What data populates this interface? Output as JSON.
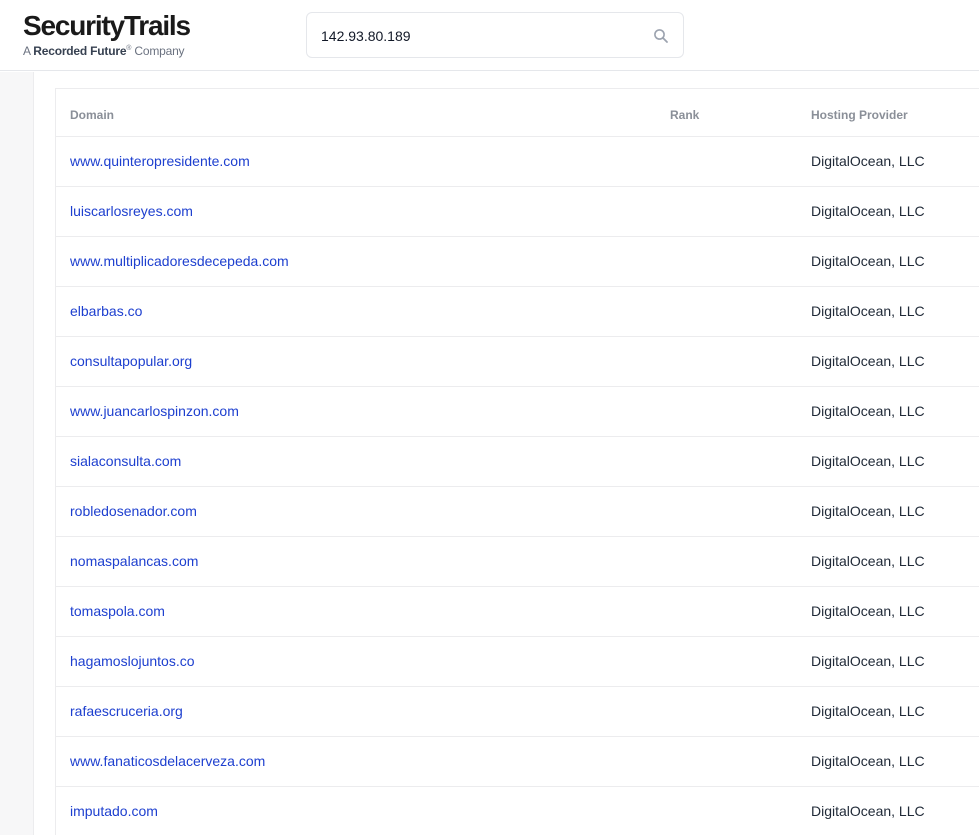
{
  "header": {
    "logo_main": "SecurityTrails",
    "logo_sub_prefix": "A ",
    "logo_sub_brand": "Recorded Future",
    "logo_sub_reg": "®",
    "logo_sub_suffix": " Company"
  },
  "search": {
    "value": "142.93.80.189",
    "icon": "search-icon"
  },
  "table": {
    "columns": {
      "domain": "Domain",
      "rank": "Rank",
      "hosting": "Hosting Provider"
    },
    "rows": [
      {
        "domain": "www.quinteropresidente.com",
        "rank": "",
        "hosting": "DigitalOcean, LLC"
      },
      {
        "domain": "luiscarlosreyes.com",
        "rank": "",
        "hosting": "DigitalOcean, LLC"
      },
      {
        "domain": "www.multiplicadoresdecepeda.com",
        "rank": "",
        "hosting": "DigitalOcean, LLC"
      },
      {
        "domain": "elbarbas.co",
        "rank": "",
        "hosting": "DigitalOcean, LLC"
      },
      {
        "domain": "consultapopular.org",
        "rank": "",
        "hosting": "DigitalOcean, LLC"
      },
      {
        "domain": "www.juancarlospinzon.com",
        "rank": "",
        "hosting": "DigitalOcean, LLC"
      },
      {
        "domain": "sialaconsulta.com",
        "rank": "",
        "hosting": "DigitalOcean, LLC"
      },
      {
        "domain": "robledosenador.com",
        "rank": "",
        "hosting": "DigitalOcean, LLC"
      },
      {
        "domain": "nomaspalancas.com",
        "rank": "",
        "hosting": "DigitalOcean, LLC"
      },
      {
        "domain": "tomaspola.com",
        "rank": "",
        "hosting": "DigitalOcean, LLC"
      },
      {
        "domain": "hagamoslojuntos.co",
        "rank": "",
        "hosting": "DigitalOcean, LLC"
      },
      {
        "domain": "rafaescruceria.org",
        "rank": "",
        "hosting": "DigitalOcean, LLC"
      },
      {
        "domain": "www.fanaticosdelacerveza.com",
        "rank": "",
        "hosting": "DigitalOcean, LLC"
      },
      {
        "domain": "imputado.com",
        "rank": "",
        "hosting": "DigitalOcean, LLC"
      }
    ]
  },
  "colors": {
    "link": "#1d3fcf",
    "header_text": "#8a8f98",
    "border": "#ececee"
  }
}
